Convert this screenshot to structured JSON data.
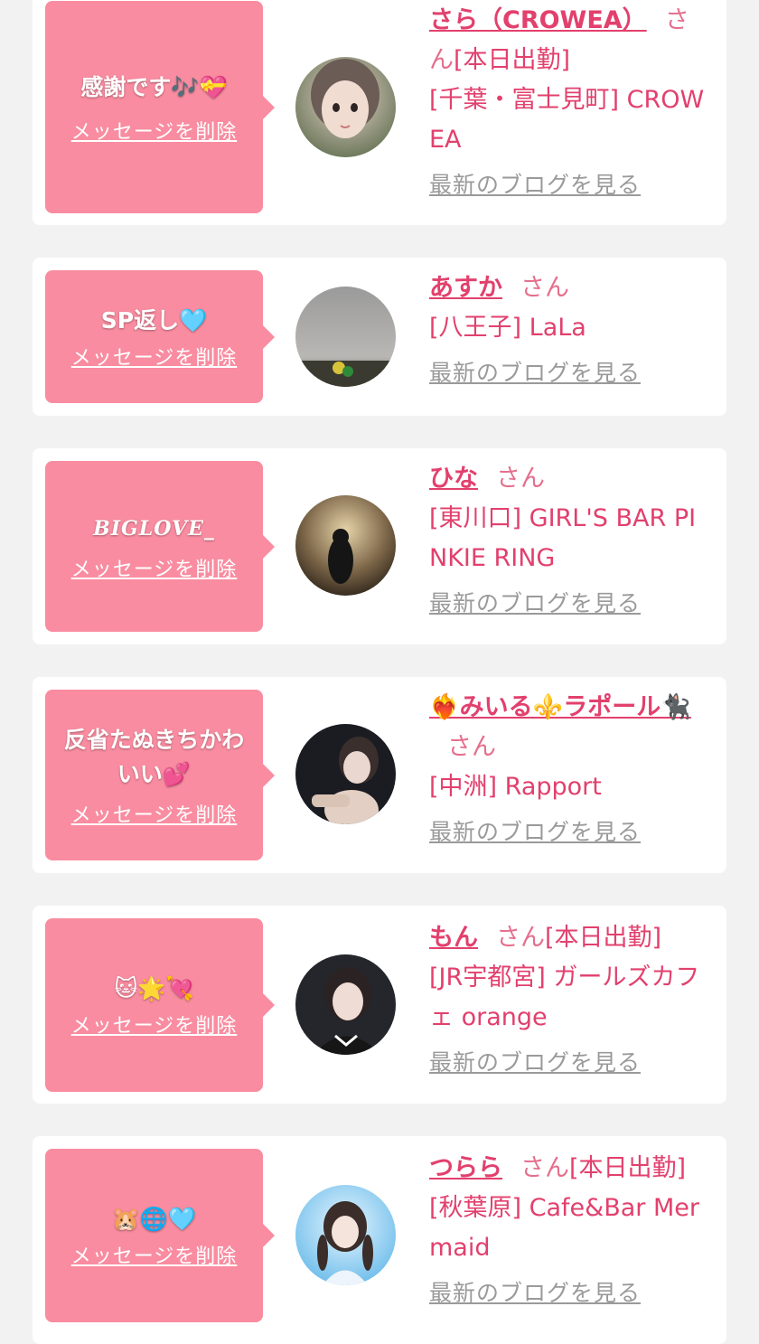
{
  "common": {
    "delete_label": "メッセージを削除",
    "san_label": "さん",
    "blog_label": "最新のブログを見る"
  },
  "colors": {
    "bubble": "#f98ca0",
    "accent": "#e2406d",
    "card": "#ffffff",
    "background": "#f3f2f2",
    "link_gray": "#9a9a9a"
  },
  "items": [
    {
      "message": "感謝です🎶💝",
      "name": "さら（CROWEA）",
      "working": "[本日出勤]",
      "shop": "[千葉・富士見町] CROWEA",
      "avatar_icon": "avatar-photo"
    },
    {
      "message": "SP返し🩵",
      "name": "あすか",
      "working": "",
      "shop": "[八王子] LaLa",
      "avatar_icon": "avatar-photo"
    },
    {
      "message": "BIGLOVE_",
      "name": "ひな",
      "working": "",
      "shop": "[東川口] GIRL'S BAR PINKIE RING",
      "avatar_icon": "avatar-photo"
    },
    {
      "message": "反省たぬきちかわいい💕",
      "name": "❤️‍🔥みいる⚜️ラポール🐈‍⬛",
      "working": "",
      "shop": "[中洲] Rapport",
      "avatar_icon": "avatar-photo"
    },
    {
      "message": "🐱🌟💘",
      "name": "もん",
      "working": "[本日出勤]",
      "shop": "[JR宇都宮] ガールズカフェ orange",
      "avatar_icon": "avatar-photo"
    },
    {
      "message": "🐹🌐🩵",
      "name": "つらら",
      "working": "[本日出勤]",
      "shop": "[秋葉原] Cafe&Bar Mermaid",
      "avatar_icon": "avatar-photo"
    }
  ]
}
